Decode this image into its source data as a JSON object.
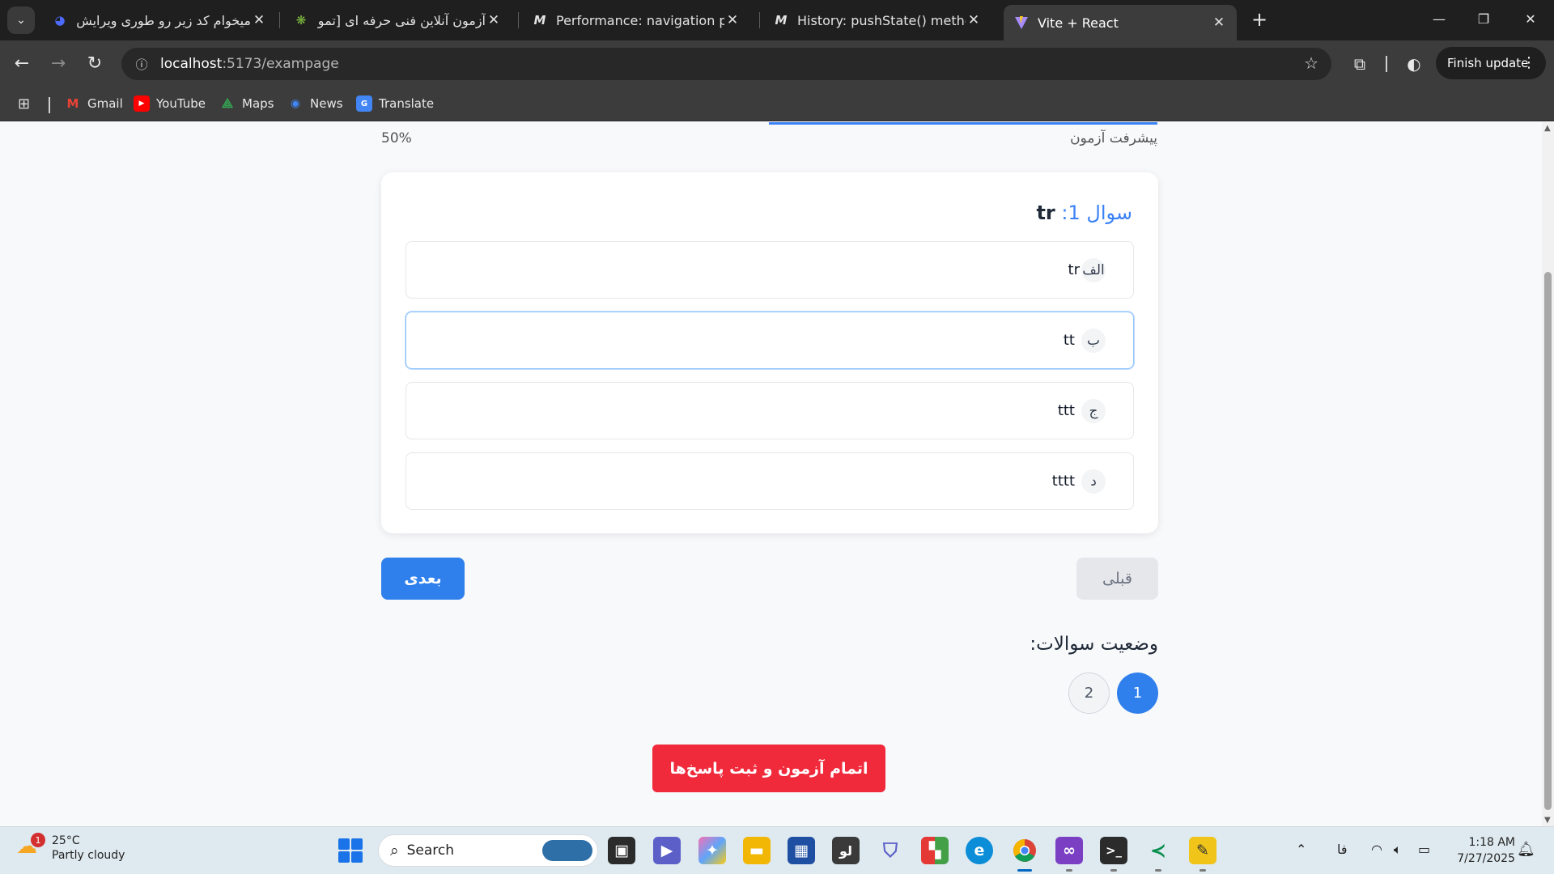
{
  "browser": {
    "tabs": [
      {
        "title": "میخوام کد زیر رو طوری ویرایش کن",
        "favicon": "deepseek-icon"
      },
      {
        "title": "آزمون آنلاین فنی حرفه ای [تمو",
        "favicon": "chatgpt-icon"
      },
      {
        "title": "Performance: navigation proper",
        "favicon": "mdn-icon"
      },
      {
        "title": "History: pushState() method - W",
        "favicon": "mdn-icon"
      },
      {
        "title": "Vite + React",
        "favicon": "vite-icon"
      }
    ],
    "active_tab": 4,
    "url_host": "localhost",
    "url_path": ":5173/exampage",
    "finish_update_label": "Finish update",
    "bookmarks": [
      {
        "label": "Gmail",
        "icon": "gmail-icon",
        "color": "#ea4335"
      },
      {
        "label": "YouTube",
        "icon": "youtube-icon",
        "color": "#ff0000"
      },
      {
        "label": "Maps",
        "icon": "maps-icon",
        "color": "#34a853"
      },
      {
        "label": "News",
        "icon": "news-icon",
        "color": "#4285f4"
      },
      {
        "label": "Translate",
        "icon": "translate-icon",
        "color": "#4285f4"
      }
    ]
  },
  "exam": {
    "progress_label": "پیشرفت آزمون",
    "progress_percent_text": "50%",
    "progress_fraction": 0.5,
    "question": {
      "prefix": "سوال 1: ",
      "text": "tr"
    },
    "options": [
      {
        "letter": "الف",
        "text": "tr",
        "selected": false
      },
      {
        "letter": "ب",
        "text": "tt",
        "selected": true
      },
      {
        "letter": "ج",
        "text": "ttt",
        "selected": false
      },
      {
        "letter": "د",
        "text": "tttt",
        "selected": false
      }
    ],
    "prev_label": "قبلی",
    "next_label": "بعدی",
    "status_title": "وضعیت سوالات:",
    "question_numbers": [
      "1",
      "2"
    ],
    "finish_label": "اتمام آزمون و ثبت پاسخ‌ها"
  },
  "taskbar": {
    "weather_temp": "25°C",
    "weather_desc": "Partly cloudy",
    "weather_badge": "1",
    "search_placeholder": "Search",
    "language": "فا",
    "time": "1:18 AM",
    "date": "7/27/2025",
    "pinned_word_icon_text": "لو"
  },
  "colors": {
    "accent": "#2f80ed",
    "danger": "#f0293b",
    "selected_border": "#93c5fd"
  }
}
